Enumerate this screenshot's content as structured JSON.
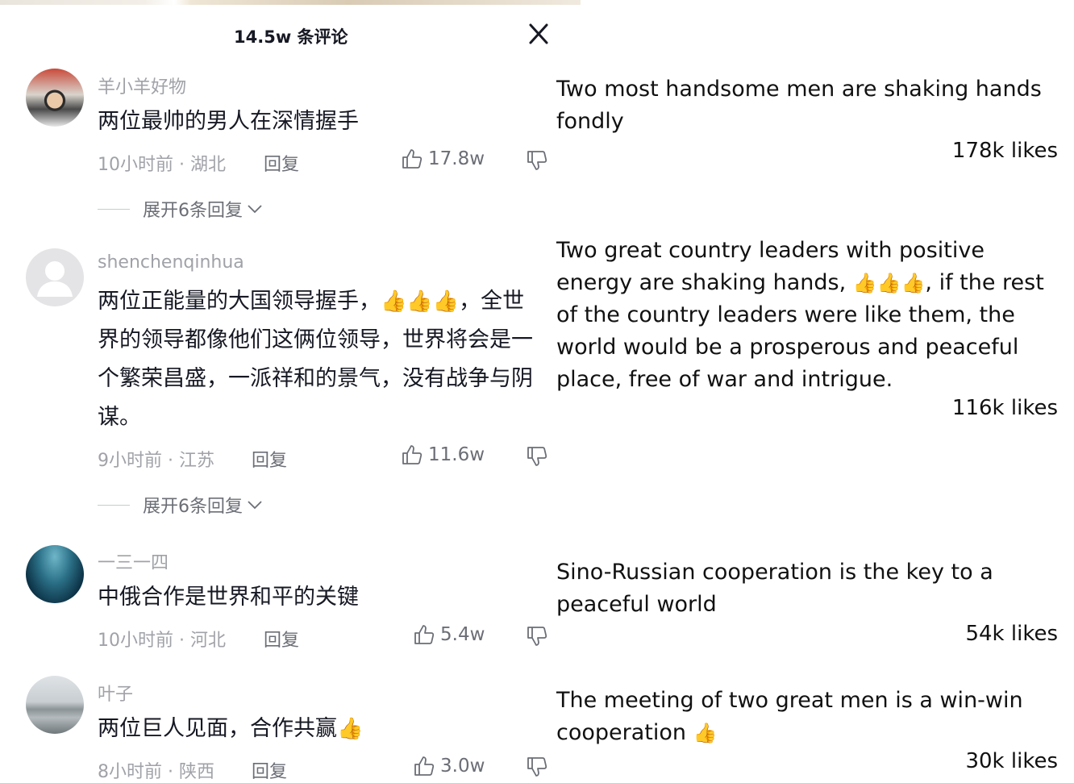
{
  "header": {
    "title": "14.5w 条评论",
    "close_icon": "close-icon"
  },
  "comments": [
    {
      "username": "羊小羊好物",
      "text": "两位最帅的男人在深情握手",
      "meta": "10小时前 · 湖北",
      "reply_label": "回复",
      "likes": "17.8w",
      "expand_label": "展开6条回复",
      "translation": "Two most handsome men are shaking hands fondly",
      "translation_likes": "178k likes"
    },
    {
      "username": "shenchenqinhua",
      "text_before": "两位正能量的大国领导握手，",
      "text_thumbs": "👍👍👍",
      "text_after": "，全世界的领导都像他们这俩位领导，世界将会是一个繁荣昌盛，一派祥和的景气，没有战争与阴谋。",
      "meta": "9小时前 · 江苏",
      "reply_label": "回复",
      "likes": "11.6w",
      "expand_label": "展开6条回复",
      "translation_before": "Two great country leaders with positive energy are shaking hands, ",
      "translation_thumbs": "👍👍👍",
      "translation_after": ", if the rest of the country leaders were like them, the world would be a prosperous and peaceful place, free of war and intrigue.",
      "translation_likes": "116k likes"
    },
    {
      "username": "一三一四",
      "text": "中俄合作是世界和平的关键",
      "meta": "10小时前 · 河北",
      "reply_label": "回复",
      "likes": "5.4w",
      "translation": "Sino-Russian cooperation is the key to a peaceful world",
      "translation_likes": "54k likes"
    },
    {
      "username": "叶子",
      "text_before": "两位巨人见面，合作共赢",
      "text_thumbs": "👍",
      "meta": "8小时前 · 陕西",
      "reply_label": "回复",
      "likes": "3.0w",
      "translation_before": "The meeting of two great men is a win-win cooperation ",
      "translation_thumbs": "👍",
      "translation_likes": "30k likes"
    }
  ],
  "colors": {
    "text": "#161823",
    "muted": "#a0a2a8",
    "action": "#6b6e76",
    "thumb": "#f5a623"
  }
}
